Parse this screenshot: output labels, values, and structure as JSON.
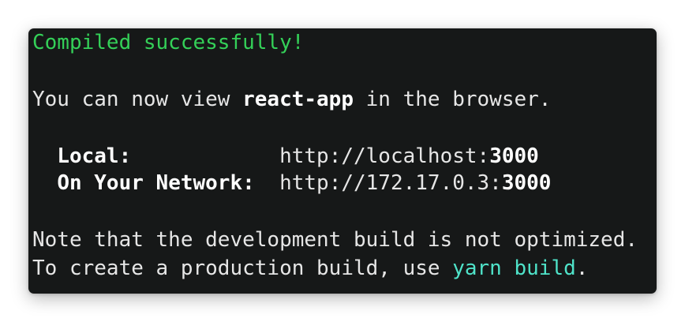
{
  "terminal": {
    "compiled_message": "Compiled successfully!",
    "view_prefix": "You can now view ",
    "app_name": "react-app",
    "view_suffix": " in the browser.",
    "local": {
      "label": "Local:",
      "url_prefix": "http://localhost:",
      "port": "3000"
    },
    "network": {
      "label": "On Your Network:",
      "url_prefix": "http://172.17.0.3:",
      "port": "3000"
    },
    "note": "Note that the development build is not optimized.",
    "build_prefix": "To create a production build, use ",
    "build_command": "yarn build",
    "build_suffix": "."
  },
  "colors": {
    "background": "#161818",
    "text": "#e6e6e6",
    "success": "#34d058",
    "command": "#4fe3c9"
  }
}
